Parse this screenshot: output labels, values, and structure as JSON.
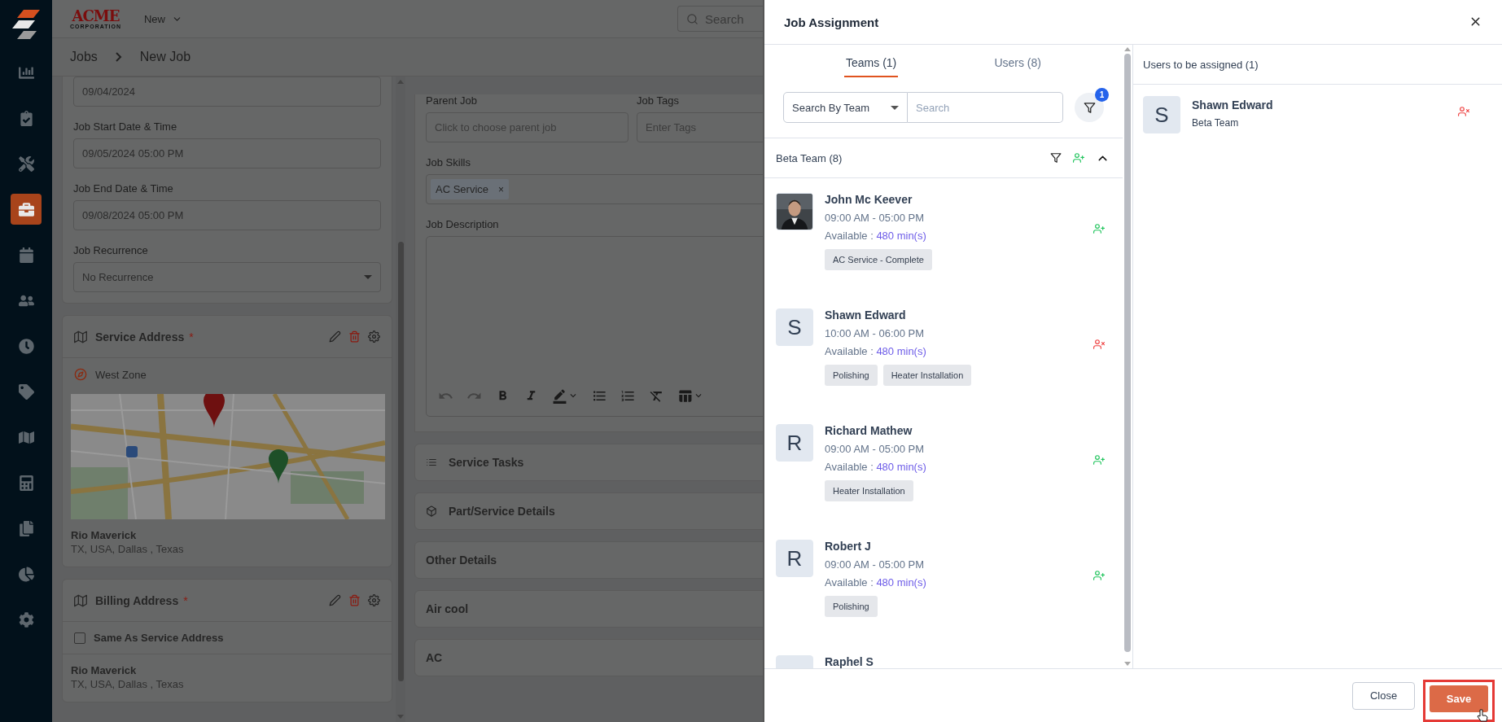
{
  "sidebar": {
    "items": [
      {
        "selected": false
      },
      {
        "selected": false
      },
      {
        "selected": false
      },
      {
        "selected": true
      },
      {
        "selected": false
      },
      {
        "selected": false
      },
      {
        "selected": false
      },
      {
        "selected": false
      },
      {
        "selected": false
      },
      {
        "selected": false
      },
      {
        "selected": false
      },
      {
        "selected": false
      },
      {
        "selected": false
      }
    ]
  },
  "topbar": {
    "logo": "ACME",
    "logo_sub": "CORPORATION",
    "menu": "New",
    "search": {
      "placeholder": "Search"
    }
  },
  "breadcrumb": [
    "Jobs",
    "New Job"
  ],
  "schedule": {
    "date_value": "09/04/2024",
    "fields": [
      {
        "label": "Job Start Date & Time",
        "value": "09/05/2024 05:00 PM"
      },
      {
        "label": "Job End Date & Time",
        "value": "09/08/2024 05:00 PM"
      }
    ],
    "recurrence": {
      "label": "Job Recurrence",
      "value": "No Recurrence"
    }
  },
  "service_address": {
    "title": "Service Address",
    "required": "*",
    "zone": "West Zone",
    "map": {
      "kind": "picture"
    },
    "name": "Rio Maverick",
    "address": "TX, USA, Dallas , Texas"
  },
  "billing_address": {
    "title": "Billing Address",
    "required": "*",
    "same_as": {
      "label": "Same As Service Address",
      "checked": false
    },
    "name": "Rio Maverick",
    "address": "TX, USA, Dallas , Texas"
  },
  "details": {
    "parent_job": {
      "label": "Parent Job",
      "placeholder": "Click to choose parent job"
    },
    "job_tags": {
      "label": "Job Tags",
      "placeholder": "Enter Tags"
    },
    "job_skills": {
      "label": "Job Skills",
      "chips": [
        "AC Service"
      ],
      "chip_remove": "×"
    },
    "job_description": {
      "label": "Job Description"
    }
  },
  "sections": [
    {
      "title": "Service Tasks",
      "kind": "tasks"
    },
    {
      "title": "Part/Service Details",
      "kind": "parts"
    },
    {
      "title": "Other Details",
      "kind": "plain"
    },
    {
      "title": "Air cool",
      "kind": "plain"
    },
    {
      "title": "AC",
      "kind": "plain"
    }
  ],
  "drawer": {
    "title": "Job Assignment",
    "tabs": [
      {
        "label": "Teams (1)",
        "selected": true
      },
      {
        "label": "Users (8)",
        "selected": false
      }
    ],
    "search_by": "Search By Team",
    "search": {
      "placeholder": "Search"
    },
    "filter_badge": "1",
    "group": {
      "title": "Beta Team (8)",
      "expanded": true
    },
    "users": [
      {
        "name": "John Mc Keever",
        "photo": {
          "kind": "picture"
        },
        "hours": "09:00 AM - 05:00 PM",
        "available_label": "Available :",
        "available_value": "480 min(s)",
        "skills": [
          "AC Service - Complete"
        ],
        "assigned": false
      },
      {
        "name": "Shawn Edward",
        "initial": "S",
        "hours": "10:00 AM - 06:00 PM",
        "available_label": "Available :",
        "available_value": "480 min(s)",
        "skills": [
          "Polishing",
          "Heater Installation"
        ],
        "assigned": true
      },
      {
        "name": "Richard Mathew",
        "initial": "R",
        "hours": "09:00 AM - 05:00 PM",
        "available_label": "Available :",
        "available_value": "480 min(s)",
        "skills": [
          "Heater Installation"
        ],
        "assigned": false
      },
      {
        "name": "Robert J",
        "initial": "R",
        "hours": "09:00 AM - 05:00 PM",
        "available_label": "Available :",
        "available_value": "480 min(s)",
        "skills": [
          "Polishing"
        ],
        "assigned": false
      },
      {
        "name": "Raphel S"
      }
    ],
    "assigned_title": "Users to be assigned (1)",
    "assigned": [
      {
        "initial": "S",
        "name": "Shawn Edward",
        "team": "Beta Team"
      }
    ],
    "close": "Close",
    "save": {
      "label": "Save",
      "highlighted": true
    }
  }
}
